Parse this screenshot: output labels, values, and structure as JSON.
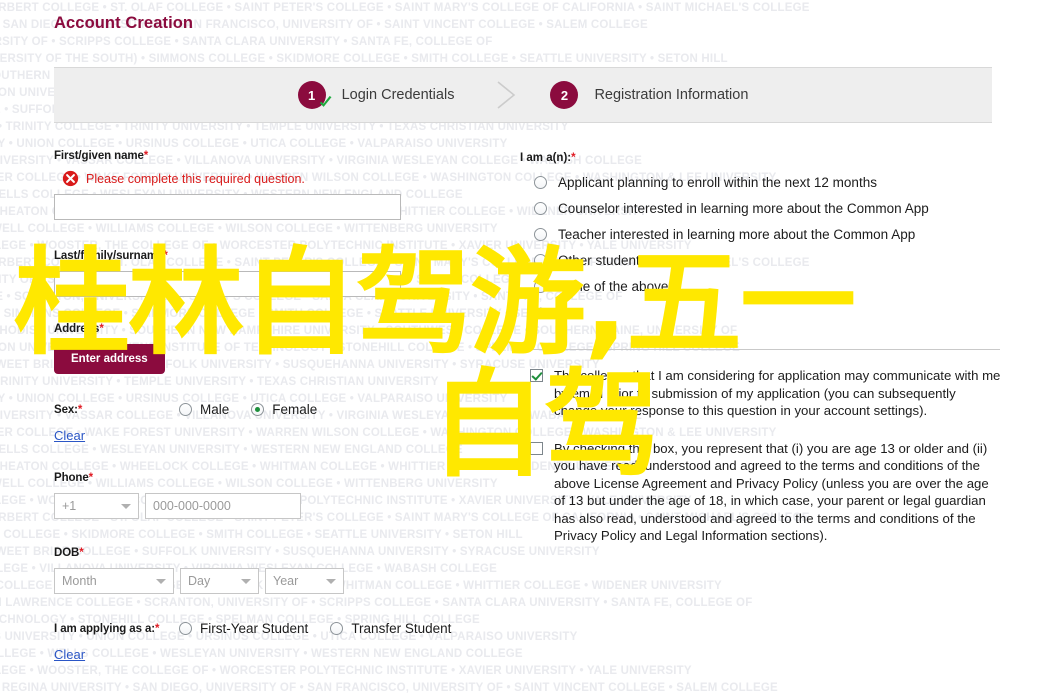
{
  "page": {
    "title": "Account Creation",
    "accent_color": "#8b0b3e",
    "error_color": "#d91b1b",
    "link_color": "#2b56c6",
    "overlay_color": "#ffe800"
  },
  "watermark": {
    "lines": [
      "ST. NORBERT COLLEGE • ST. OLAF COLLEGE • SAINT PETER'S COLLEGE • SAINT MARY'S COLLEGE OF CALIFORNIA • SAINT MICHAEL'S COLLEGE",
      "SALVE REGINA UNIVERSITY • SAN DIEGO, UNIVERSITY OF • SAN FRANCISCO, UNIVERSITY OF • SAINT VINCENT COLLEGE • SALEM COLLEGE",
      "SARAH LAWRENCE COLLEGE • SCRANTON, UNIVERSITY OF • SCRIPPS COLLEGE • SANTA CLARA UNIVERSITY • SANTA FE, COLLEGE OF",
      "SEWANEE (UNIVERSITY OF THE SOUTH) • SIMMONS COLLEGE • SKIDMORE COLLEGE • SMITH COLLEGE • SEATTLE UNIVERSITY • SETON HILL",
      "SOUTHERN METHODIST UNIVERSITY • SOUTHERN NEW HAMPSHIRE UNIVERSITY • SOUTHWEST COLLEGE • SOUTHERN MAINE, UNIVERSITY OF",
      "STETSON UNIVERSITY • STEVENS INSTITUTE OF TECHNOLOGY • STONEHILL COLLEGE • SPELMAN COLLEGE • SPRING HILL COLLEGE",
      "SWARTHMORE COLLEGE • SWEET BRIAR COLLEGE • SUFFOLK UNIVERSITY • SUSQUEHANNA UNIVERSITY • SYRACUSE UNIVERSITY",
      "TRANSYLVANIA UNIVERSITY • TRINITY COLLEGE • TRINITY UNIVERSITY • TEMPLE UNIVERSITY • TEXAS CHRISTIAN UNIVERSITY",
      "TULANE UNIVERSITY • TUFTS UNIVERSITY • UNION COLLEGE • URSINUS COLLEGE • UTICA COLLEGE • VALPARAISO UNIVERSITY",
      "VANDERBILT UNIVERSITY • VASSAR COLLEGE • VILLANOVA UNIVERSITY • VIRGINIA WESLEYAN COLLEGE • WABASH COLLEGE",
      "WAGNER COLLEGE • WAKE FOREST UNIVERSITY • WARREN WILSON COLLEGE • WASHINGTON COLLEGE • WASHINGTON & LEE UNIVERSITY",
      "WEBSTER UNIVERSITY • WELLESLEY COLLEGE • WELLS COLLEGE • WESLEYAN UNIVERSITY • WESTERN NEW ENGLAND COLLEGE",
      "WESTMINSTER COLLEGE • WHEATON COLLEGE • WHEELOCK COLLEGE • WHITMAN COLLEGE • WHITTIER COLLEGE • WIDENER UNIVERSITY",
      "WILLAMETTE UNIVERSITY • WILLIAM JEWELL COLLEGE • WILLIAMS COLLEGE • WILSON COLLEGE • WITTENBERG UNIVERSITY",
      "WOFFORD COLLEGE • WOOSTER, THE COLLEGE OF • WORCESTER POLYTECHNIC INSTITUTE • XAVIER UNIVERSITY • YALE UNIVERSITY"
    ]
  },
  "stepper": {
    "steps": [
      {
        "number": "1",
        "label": "Login Credentials",
        "complete": true
      },
      {
        "number": "2",
        "label": "Registration Information",
        "complete": false
      }
    ]
  },
  "left_form": {
    "first_name": {
      "label": "First/given name",
      "required_mark": "*",
      "error": "Please complete this required question.",
      "value": "",
      "placeholder": ""
    },
    "last_name": {
      "label": "Last/family/surname",
      "required_mark": "*",
      "value": "",
      "placeholder": ""
    },
    "address": {
      "label": "Address",
      "required_mark": "*",
      "button_label": "Enter address"
    },
    "sex": {
      "label": "Sex:",
      "required_mark": "*",
      "options": [
        {
          "label": "Male",
          "checked": false
        },
        {
          "label": "Female",
          "checked": true
        }
      ],
      "clear_label": "Clear"
    },
    "phone": {
      "label": "Phone",
      "required_mark": "*",
      "country_code": "+1",
      "number_placeholder": "000-000-0000",
      "number_value": ""
    },
    "dob": {
      "label": "DOB",
      "required_mark": "*",
      "month": "Month",
      "day": "Day",
      "year": "Year"
    },
    "applying_as": {
      "label": "I am applying as a:",
      "required_mark": "*",
      "options": [
        {
          "label": "First-Year Student",
          "checked": false
        },
        {
          "label": "Transfer Student",
          "checked": false
        }
      ],
      "clear_label": "Clear"
    }
  },
  "right_form": {
    "i_am_a": {
      "label": "I am a(n):",
      "required_mark": "*",
      "options": [
        {
          "label": "Applicant planning to enroll within the next 12 months",
          "checked": false
        },
        {
          "label": "Counselor interested in learning more about the Common App",
          "checked": false
        },
        {
          "label": "Teacher interested in learning more about the Common App",
          "checked": false
        },
        {
          "label": "Other student",
          "checked": false
        },
        {
          "label": "None of the above",
          "checked": false
        }
      ],
      "clear_label": "Clear"
    },
    "consents": [
      {
        "checked": true,
        "text": "The colleges that I am considering for application may communicate with me by email prior to submission of my application (you can subsequently change your response to this question in your account settings)."
      },
      {
        "checked": false,
        "text": "By checking this box, you represent that (i) you are age 13 or older and (ii) you have read, understood and agreed to the terms and conditions of the above License Agreement and Privacy Policy (unless you are over the age of 13 but under the age of 18, in which case, your parent or legal guardian has also read, understood and agreed to the terms and conditions of the Privacy Policy and Legal Information sections)."
      }
    ]
  },
  "overlay": {
    "line1": "桂林自驾游,五一",
    "line2": "自驾"
  }
}
